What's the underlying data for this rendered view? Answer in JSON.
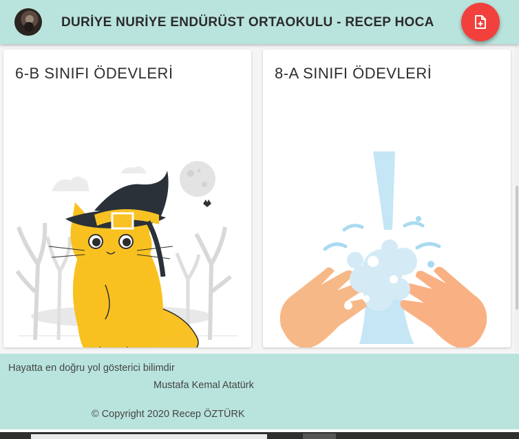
{
  "header": {
    "title": "DURİYE NURİYE ENDÜRÜST ORTAOKULU - RECEP HOCA",
    "avatar_icon": "user-avatar",
    "fab_icon": "add-document-icon",
    "background": "#b9e4dd",
    "fab_color": "#f2413d"
  },
  "cards": [
    {
      "title": "6-B SINIFI ÖDEVLERİ",
      "illustration": "halloween-cat-illustration"
    },
    {
      "title": "8-A SINIFI ÖDEVLERİ",
      "illustration": "hand-washing-illustration"
    }
  ],
  "footer": {
    "quote": "Hayatta en doğru yol gösterici bilimdir",
    "author": "Mustafa Kemal Atatürk",
    "copyright": "© Copyright 2020 Recep ÖZTÜRK",
    "background": "#b9e4dd"
  }
}
